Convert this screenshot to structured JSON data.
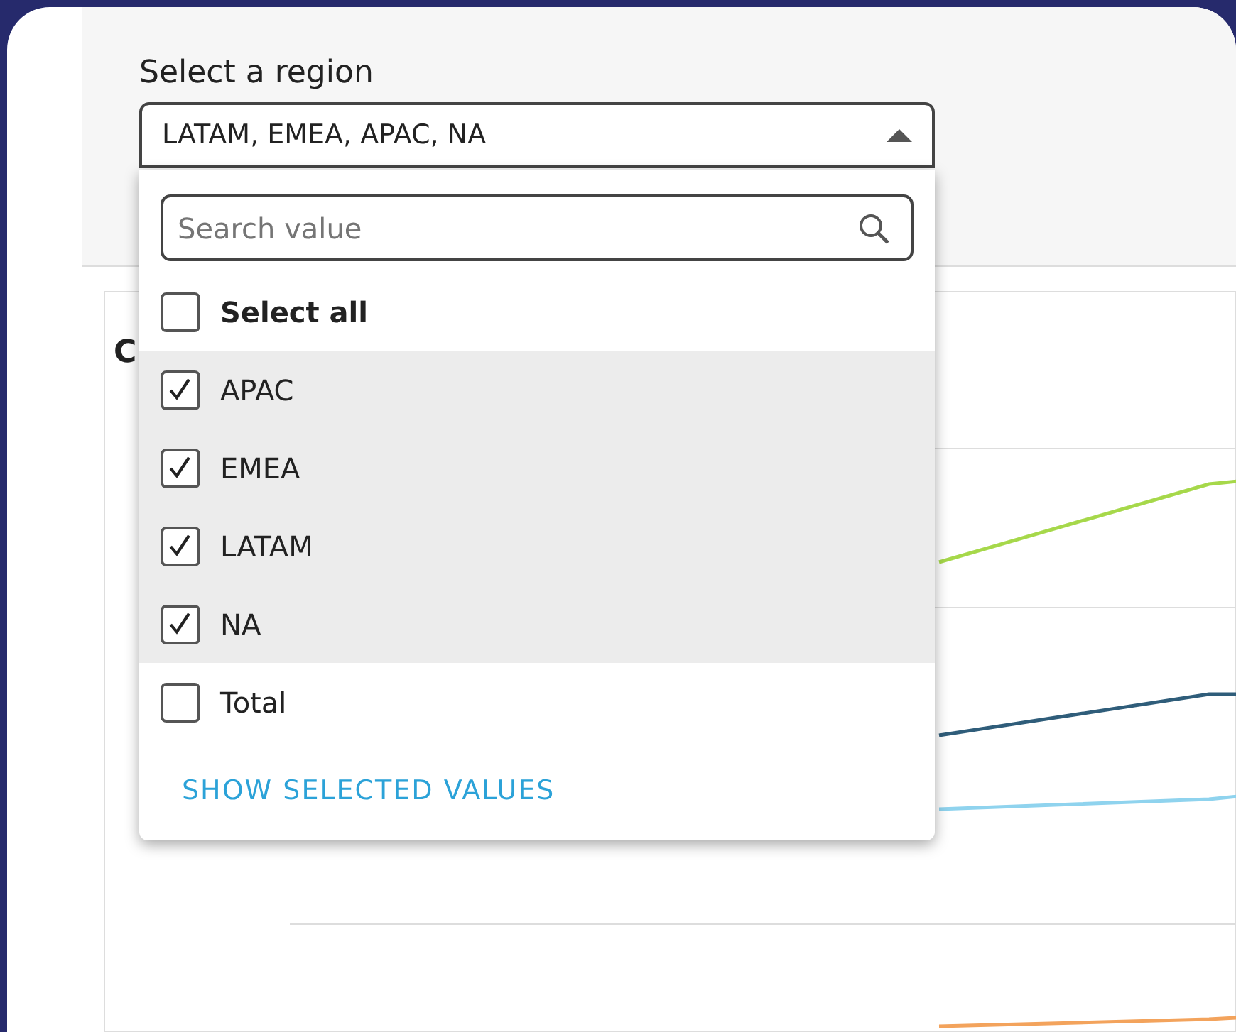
{
  "filter": {
    "label": "Select a region",
    "value": "LATAM, EMEA, APAC, NA",
    "expanded": true
  },
  "dropdown": {
    "search": {
      "placeholder": "Search value"
    },
    "options": [
      {
        "label": "Select all",
        "checked": false,
        "kind": "all"
      },
      {
        "label": "APAC",
        "checked": true,
        "kind": "value"
      },
      {
        "label": "EMEA",
        "checked": true,
        "kind": "value"
      },
      {
        "label": "LATAM",
        "checked": true,
        "kind": "value"
      },
      {
        "label": "NA",
        "checked": true,
        "kind": "value"
      },
      {
        "label": "Total",
        "checked": false,
        "kind": "value"
      }
    ],
    "link": "SHOW SELECTED VALUES"
  },
  "chart": {
    "title": "C",
    "lines": [
      {
        "color": "#a6d84a"
      },
      {
        "color": "#2f5d7a"
      },
      {
        "color": "#8fd3ee"
      },
      {
        "color": "#f3a35c"
      }
    ]
  }
}
